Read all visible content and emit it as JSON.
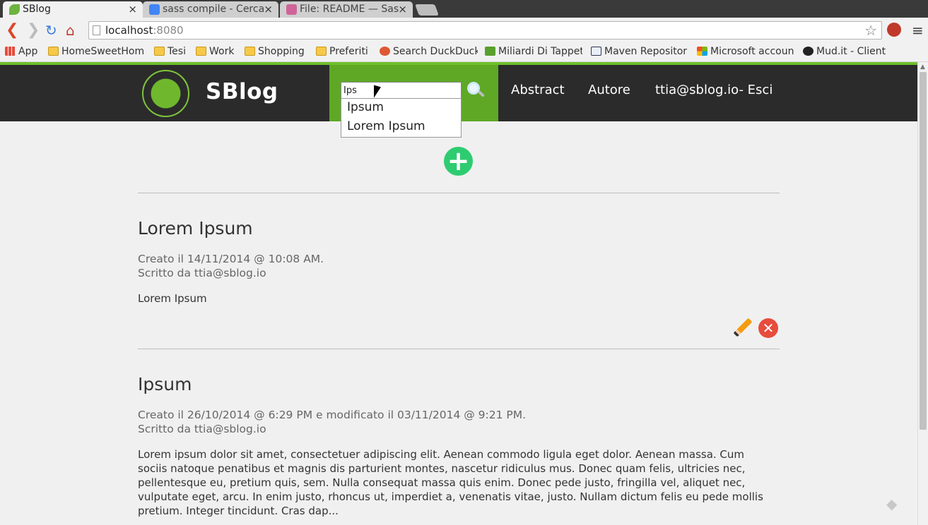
{
  "browser": {
    "tabs": [
      {
        "title": "SBlog",
        "active": true,
        "icon": "spring-leaf-icon",
        "color": "#6db33f"
      },
      {
        "title": "sass compile - Cerca",
        "active": false,
        "icon": "google-icon",
        "color": "#4285f4"
      },
      {
        "title": "File: README — Sas",
        "active": false,
        "icon": "sass-icon",
        "color": "#cf649a"
      }
    ],
    "close_glyph": "×",
    "url_host": "localhost",
    "url_port": ":8080",
    "bookmarks": [
      {
        "label": "App",
        "icon": "apps-grid-icon"
      },
      {
        "label": "HomeSweetHom",
        "icon": "folder-icon"
      },
      {
        "label": "Tesi",
        "icon": "folder-icon"
      },
      {
        "label": "Work",
        "icon": "folder-icon"
      },
      {
        "label": "Shopping",
        "icon": "folder-icon"
      },
      {
        "label": "Preferiti",
        "icon": "folder-icon"
      },
      {
        "label": "Search DuckDuck",
        "icon": "duckduckgo-icon"
      },
      {
        "label": "Miliardi Di Tappet",
        "icon": "ln-icon"
      },
      {
        "label": "Maven Repositor",
        "icon": "mvn-icon"
      },
      {
        "label": "Microsoft accoun",
        "icon": "microsoft-icon"
      },
      {
        "label": "Mud.it - Client",
        "icon": "mud-icon"
      }
    ]
  },
  "site": {
    "brand": "SBlog",
    "search_value": "Ips",
    "suggestions": [
      "Ipsum",
      "Lorem Ipsum"
    ],
    "nav": [
      "Abstract",
      "Autore",
      "ttia@sblog.io- Esci"
    ],
    "add_glyph": "+",
    "accent": "#5ea826",
    "header_bg": "#2b2b2b"
  },
  "posts": [
    {
      "title": "Lorem Ipsum",
      "created": "Creato il 14/11/2014 @ 10:08 AM.",
      "author": "Scritto da ttia@sblog.io",
      "body": "Lorem Ipsum"
    },
    {
      "title": "Ipsum",
      "created": "Creato il 26/10/2014 @ 6:29 PM e modificato il 03/11/2014 @ 9:21 PM.",
      "author": "Scritto da ttia@sblog.io",
      "body": "Lorem ipsum dolor sit amet, consectetuer adipiscing elit. Aenean commodo ligula eget dolor. Aenean massa. Cum sociis natoque penatibus et magnis dis parturient montes, nascetur ridiculus mus. Donec quam felis, ultricies nec, pellentesque eu, pretium quis, sem. Nulla consequat massa quis enim. Donec pede justo, fringilla vel, aliquet nec, vulputate eget, arcu. In enim justo, rhoncus ut, imperdiet a, venenatis vitae, justo. Nullam dictum felis eu pede mollis pretium. Integer tincidunt. Cras dap..."
    }
  ],
  "delete_glyph": "✕"
}
